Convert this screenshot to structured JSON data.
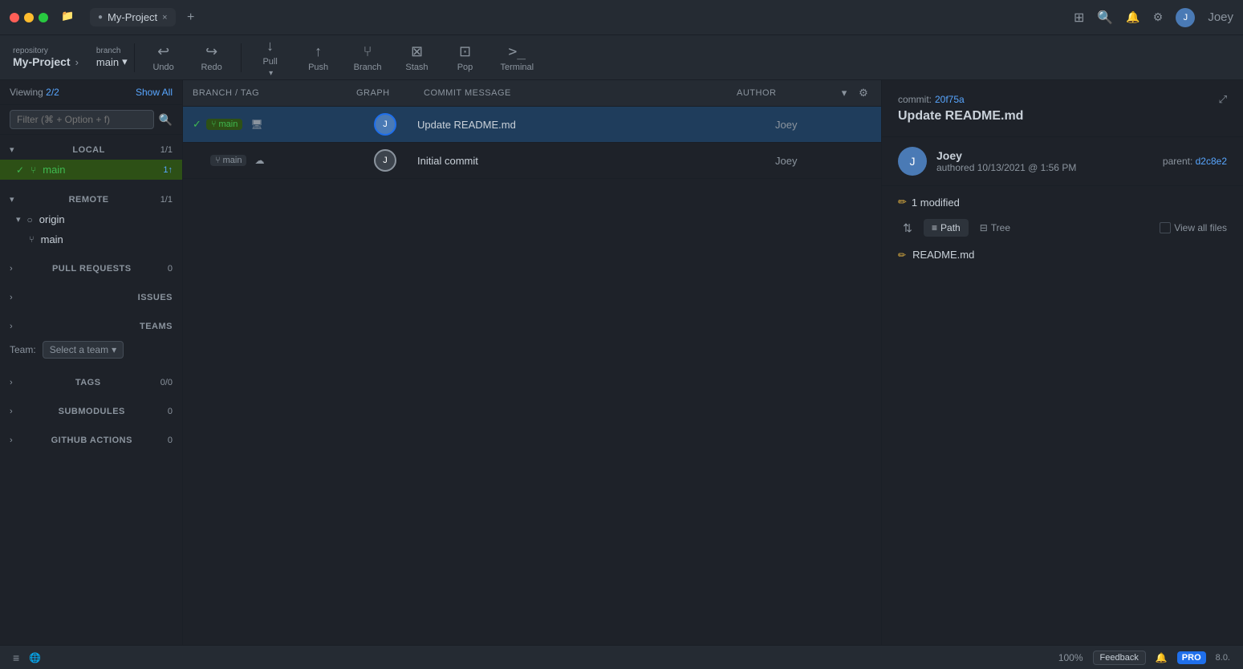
{
  "window": {
    "traffic_lights": [
      "red",
      "yellow",
      "green"
    ],
    "tab_title": "My-Project",
    "tab_close": "×",
    "new_tab": "+"
  },
  "header_right": {
    "dropdown_icon": "▾",
    "bell_icon": "🔔",
    "gear_icon": "⚙",
    "user_name": "Joey",
    "search_icon": "🔍",
    "split_icon": "⊞"
  },
  "repo": {
    "label": "repository",
    "name": "My-Project",
    "arrow": "›"
  },
  "branch_selector": {
    "label": "branch",
    "name": "main",
    "dropdown": "▾"
  },
  "toolbar": {
    "undo_label": "Undo",
    "redo_label": "Redo",
    "pull_label": "Pull",
    "push_label": "Push",
    "branch_label": "Branch",
    "stash_label": "Stash",
    "pop_label": "Pop",
    "terminal_label": "Terminal",
    "undo_icon": "↩",
    "redo_icon": "↪",
    "pull_icon": "↓",
    "push_icon": "↑",
    "branch_icon": "⑂",
    "stash_icon": "⊠",
    "pop_icon": "⊡",
    "terminal_icon": ">_"
  },
  "sidebar": {
    "viewing_label": "Viewing",
    "viewing_count": "2/2",
    "show_all": "Show All",
    "search_placeholder": "Filter (⌘ + Option + f)",
    "search_icon": "🔍",
    "local_label": "LOCAL",
    "local_count": "1/1",
    "local_expand": "›",
    "main_branch": "main",
    "main_badge": "1↑",
    "remote_label": "REMOTE",
    "remote_count": "1/1",
    "remote_expand": "›",
    "origin_label": "origin",
    "origin_main": "main",
    "pull_requests_label": "PULL REQUESTS",
    "pull_requests_count": "0",
    "issues_label": "ISSUES",
    "teams_label": "TEAMS",
    "team_select_placeholder": "Select a team",
    "team_dropdown": "▾",
    "team_label": "Team:",
    "tags_label": "TAGS",
    "tags_count": "0/0",
    "submodules_label": "SUBMODULES",
    "submodules_count": "0",
    "github_actions_label": "GITHUB ACTIONS",
    "github_actions_count": "0"
  },
  "commit_list": {
    "col_branch": "BRANCH / TAG",
    "col_graph": "GRAPH",
    "col_message": "COMMIT MESSAGE",
    "col_author": "AUTHOR",
    "commits": [
      {
        "selected": true,
        "check": "✓",
        "branch": "main",
        "branch_type": "active",
        "message": "Update README.md",
        "author": "Joey"
      },
      {
        "selected": false,
        "check": "",
        "branch": "main",
        "branch_type": "remote",
        "message": "Initial commit",
        "author": "Joey"
      }
    ]
  },
  "right_panel": {
    "commit_title": "Update README.md",
    "commit_hash_label": "commit:",
    "commit_hash": "20f75a",
    "expand_icon": "⤢",
    "author_name": "Joey",
    "authored_label": "authored",
    "commit_date": "10/13/2021 @ 1:56 PM",
    "parent_label": "parent:",
    "parent_hash": "d2c8e2",
    "modified_count": "1 modified",
    "pencil_icon": "✏",
    "sort_icon": "⇅",
    "path_label": "Path",
    "tree_label": "Tree",
    "path_icon": "≡",
    "tree_icon": "⊟",
    "view_all_label": "View all files",
    "files": [
      {
        "icon": "✏",
        "name": "README.md"
      }
    ]
  },
  "status_bar": {
    "list_icon": "≡",
    "network_icon": "🌐",
    "zoom": "100%",
    "feedback_label": "Feedback",
    "bell_icon": "🔔",
    "pro_label": "PRO",
    "version": "8.0."
  }
}
